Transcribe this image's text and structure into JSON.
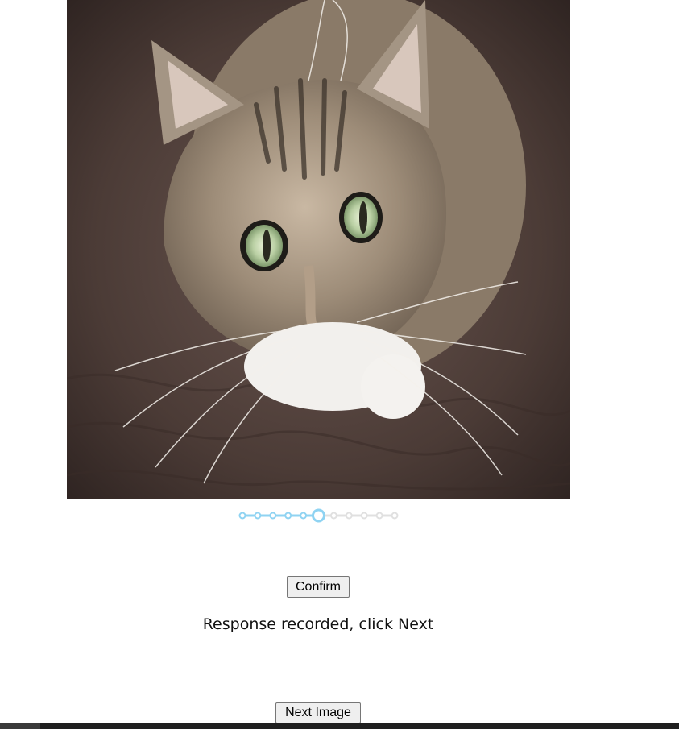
{
  "photo": {
    "subject": "tabby cat looking up"
  },
  "slider": {
    "steps": 11,
    "selected_step": 6,
    "active_color": "#8fd3f2",
    "inactive_color": "#e0e0e0"
  },
  "buttons": {
    "confirm_label": "Confirm",
    "next_label": "Next Image"
  },
  "status": {
    "message": "Response recorded, click Next"
  }
}
